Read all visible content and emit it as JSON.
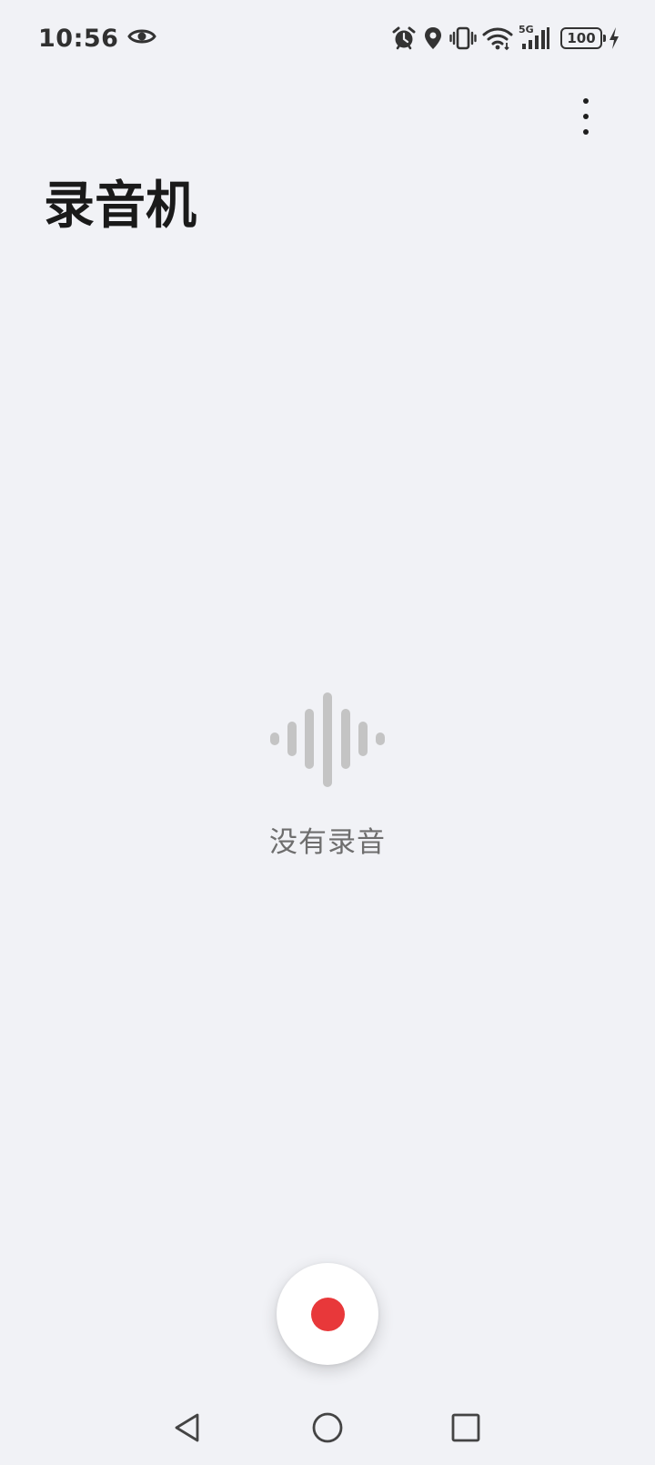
{
  "status_bar": {
    "time": "10:56",
    "network_type": "5G",
    "battery_level": "100",
    "icons": [
      "eye-icon",
      "alarm-icon",
      "location-icon",
      "vibrate-icon",
      "wifi-icon",
      "signal-icon",
      "battery-icon",
      "charging-icon"
    ]
  },
  "toolbar": {
    "overflow_icon": "more-vert-icon"
  },
  "app": {
    "title": "录音机"
  },
  "empty_state": {
    "icon": "waveform-icon",
    "message": "没有录音"
  },
  "record_button": {
    "icon": "record-icon",
    "accent_color": "#E8383A"
  },
  "navigation": {
    "icons": [
      "back-icon",
      "home-icon",
      "recents-icon"
    ]
  },
  "colors": {
    "background": "#F1F2F6",
    "title": "#1A1A1A",
    "muted_text": "#6E6E6E",
    "waveform": "#C4C4C4"
  }
}
